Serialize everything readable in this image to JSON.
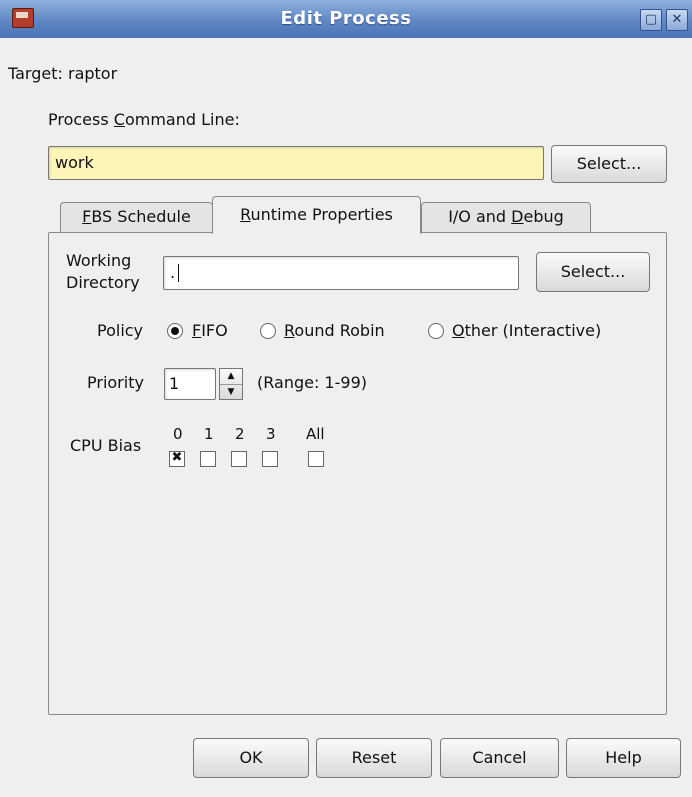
{
  "window": {
    "title": "Edit Process",
    "restore_glyph": "▢",
    "close_glyph": "✕"
  },
  "target": {
    "label": "Target:",
    "value": "raptor"
  },
  "command": {
    "label_pre": "Process ",
    "label_key": "C",
    "label_post": "ommand Line:",
    "value": "work",
    "select_label": "Select..."
  },
  "tabs": [
    {
      "pre": "",
      "key": "F",
      "post": "BS Schedule"
    },
    {
      "pre": "",
      "key": "R",
      "post": "untime Properties"
    },
    {
      "pre": "I/O and ",
      "key": "D",
      "post": "ebug"
    }
  ],
  "active_tab_index": 1,
  "runtime": {
    "working_dir_label_line1": "Working",
    "working_dir_label_line2": "Directory",
    "working_dir_value": ".",
    "working_dir_select": "Select...",
    "policy_label": "Policy",
    "policy_options": [
      {
        "pre": "",
        "key": "F",
        "post": "IFO",
        "selected": true
      },
      {
        "pre": "",
        "key": "R",
        "post": "ound Robin",
        "selected": false
      },
      {
        "pre": "",
        "key": "O",
        "post": "ther (Interactive)",
        "selected": false
      }
    ],
    "priority_label": "Priority",
    "priority_value": "1",
    "priority_range": "(Range: 1-99)",
    "spin_up_glyph": "▲",
    "spin_down_glyph": "▼",
    "cpu_bias_label": "CPU Bias",
    "cpu_bias": [
      {
        "label": "0",
        "checked": true
      },
      {
        "label": "1",
        "checked": false
      },
      {
        "label": "2",
        "checked": false
      },
      {
        "label": "3",
        "checked": false
      },
      {
        "label": "All",
        "checked": false
      }
    ]
  },
  "buttons": {
    "ok": "OK",
    "reset": "Reset",
    "cancel": "Cancel",
    "help": "Help"
  }
}
